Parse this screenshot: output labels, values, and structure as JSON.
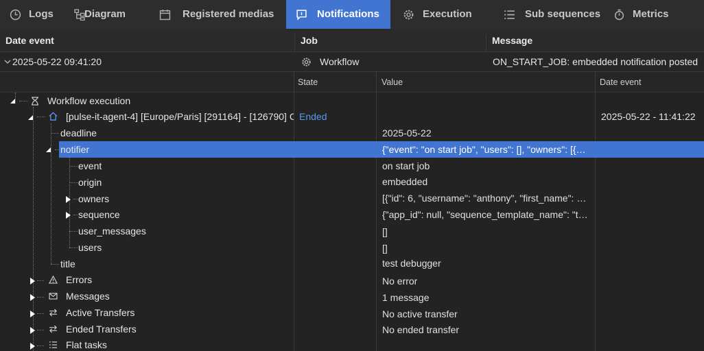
{
  "tabs": [
    {
      "label": "Logs",
      "icon": "clock-icon"
    },
    {
      "label": "Diagram",
      "icon": "diagram-icon"
    },
    {
      "label": "Registered medias",
      "icon": "calendar-icon"
    },
    {
      "label": "Notifications",
      "icon": "notification-icon",
      "active": true
    },
    {
      "label": "Execution",
      "icon": "gear-icon"
    },
    {
      "label": "Sub sequences",
      "icon": "list-icon"
    },
    {
      "label": "Metrics",
      "icon": "stopwatch-icon"
    }
  ],
  "columns": {
    "date_event": "Date event",
    "job": "Job",
    "message": "Message"
  },
  "notification": {
    "date": "2025-05-22 09:41:20",
    "job": "Workflow",
    "message": "ON_START_JOB: embedded notification posted"
  },
  "subcolumns": {
    "state": "State",
    "value": "Value",
    "date_event": "Date event"
  },
  "tree": {
    "root": "Workflow execution",
    "agent": {
      "label": "[pulse-it-agent-4] [Europe/Paris] [291164] - [126790] C",
      "state": "Ended",
      "date": "2025-05-22  -  11:41:22"
    },
    "rows": [
      {
        "label": "deadline",
        "value": "2025-05-22"
      },
      {
        "label": "notifier",
        "value": "{\"event\": \"on start job\", \"users\": [], \"owners\": [{…"
      },
      {
        "label": "event",
        "value": "on start job"
      },
      {
        "label": "origin",
        "value": "embedded"
      },
      {
        "label": "owners",
        "value": "[{\"id\": 6, \"username\": \"anthony\", \"first_name\": …"
      },
      {
        "label": "sequence",
        "value": "{\"app_id\": null, \"sequence_template_name\": \"t…"
      },
      {
        "label": "user_messages",
        "value": "[]"
      },
      {
        "label": "users",
        "value": "[]"
      },
      {
        "label": "title",
        "value": "test debugger"
      },
      {
        "label": "Errors",
        "value": "No error"
      },
      {
        "label": "Messages",
        "value": "1 message"
      },
      {
        "label": "Active Transfers",
        "value": "No active transfer"
      },
      {
        "label": "Ended Transfers",
        "value": "No ended transfer"
      },
      {
        "label": "Flat tasks",
        "value": ""
      }
    ]
  }
}
